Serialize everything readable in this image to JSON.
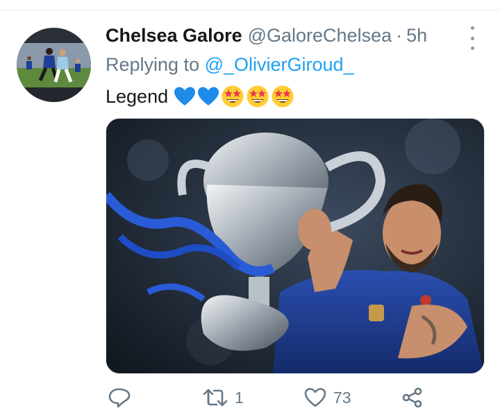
{
  "tweet": {
    "display_name": "Chelsea Galore",
    "handle": "@GaloreChelsea",
    "separator": "·",
    "time": "5h",
    "replying_prefix": "Replying to",
    "replying_to": "@_OlivierGiroud_",
    "text": "Legend",
    "emojis": [
      "blue-heart",
      "blue-heart",
      "star-struck",
      "star-struck",
      "star-struck"
    ]
  },
  "actions": {
    "reply_count": "",
    "retweet_count": "1",
    "like_count": "73"
  },
  "colors": {
    "accent": "#1da1f2",
    "secondary_text": "#657786",
    "primary_text": "#14171a",
    "chelsea_blue": "#1f3f95"
  }
}
